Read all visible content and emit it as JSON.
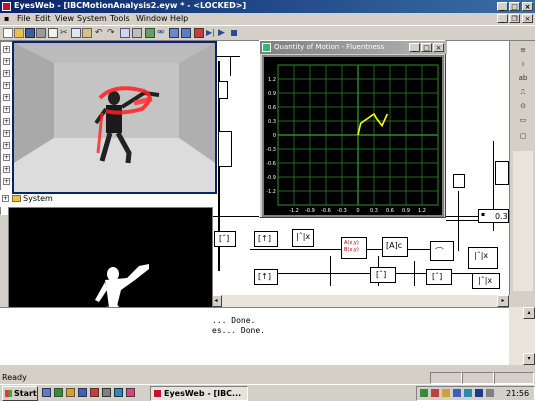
{
  "window": {
    "title": "EyesWeb - [IBCMotionAnalysis2.eyw * - <LOCKED>]"
  },
  "menu": [
    "File",
    "Edit",
    "View",
    "System",
    "Tools",
    "Window",
    "Help"
  ],
  "tree": {
    "system_label": "System"
  },
  "qom_window": {
    "title": "Quantity of Motion - Fluentness",
    "chart_data": {
      "type": "line",
      "title": "",
      "x_ticks": [
        "-1.2",
        "-0.9",
        "-0.6",
        "-0.3",
        "0",
        "0.3",
        "0.6",
        "0.9",
        "1.2"
      ],
      "y_ticks": [
        "1.2",
        "0.9",
        "0.6",
        "0.3",
        "0",
        "-0.3",
        "-0.6",
        "-0.9",
        "-1.2"
      ],
      "xlim": [
        -1.5,
        1.5
      ],
      "ylim": [
        -1.5,
        1.5
      ],
      "grid": true,
      "series": [
        {
          "x": [
            0.0,
            0.05,
            0.3,
            0.35
          ],
          "y": [
            0.0,
            0.25,
            0.45,
            0.35
          ],
          "color": "#ffff00"
        },
        {
          "x": [
            0.35,
            0.45,
            0.55
          ],
          "y": [
            0.35,
            0.2,
            0.45
          ],
          "color": "#ffff00"
        }
      ]
    }
  },
  "canvas": {
    "value_block": "0.3"
  },
  "output": {
    "lines": [
      "... Done.",
      "es... Done."
    ]
  },
  "status": {
    "text": "Ready"
  },
  "taskbar": {
    "start_label": "Start",
    "app_label": "EyesWeb - [IBC...",
    "clock": "21:56"
  },
  "colors": {
    "titlebar": "#0a246a",
    "plot_grid": "#2e8b2e",
    "plot_line": "#ffff00"
  }
}
